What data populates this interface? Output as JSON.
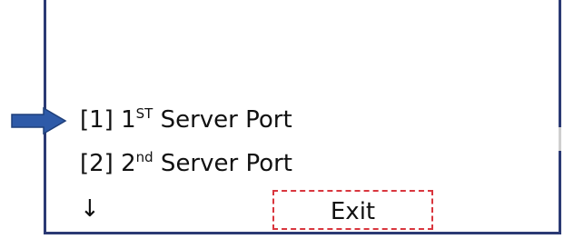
{
  "menu": {
    "items": [
      {
        "prefix": "[1] 1",
        "superscript": "ST",
        "suffix": " Server Port"
      },
      {
        "prefix": "[2] 2",
        "superscript": "nd",
        "suffix": " Server Port"
      }
    ],
    "scroll_indicator": "↓",
    "exit_label": "Exit",
    "selected_index": 0
  },
  "icons": {
    "pointer": "right-arrow-icon",
    "scroll": "down-arrow-icon"
  },
  "colors": {
    "frame": "#2b3a74",
    "pointer_fill": "#2e5aa8",
    "pointer_stroke": "#1f3f7a",
    "exit_border": "#d9363e"
  }
}
